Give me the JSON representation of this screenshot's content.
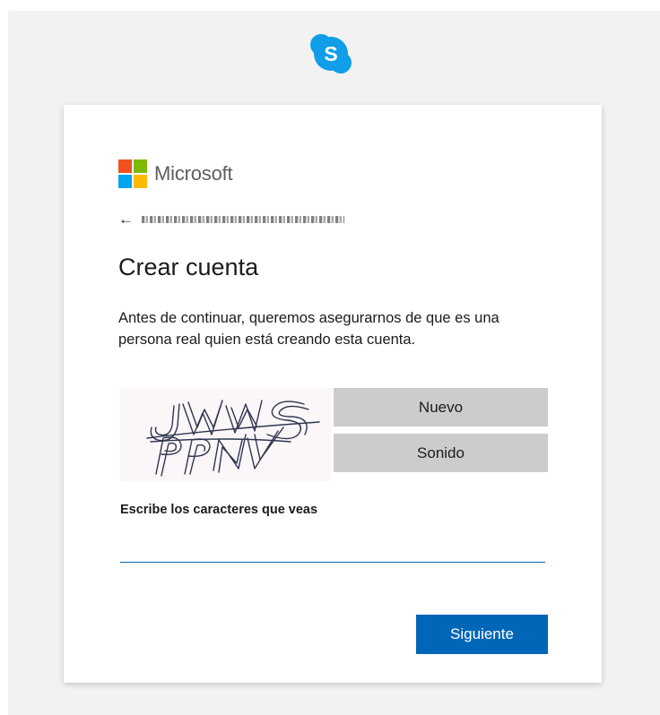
{
  "logos": {
    "skype_icon": "skype-icon",
    "microsoft_brand": "Microsoft",
    "microsoft_colors": [
      "#f25022",
      "#7fba00",
      "#00a4ef",
      "#ffb900"
    ]
  },
  "header": {
    "back_icon": "arrow-left-icon",
    "back_glyph": "←"
  },
  "main": {
    "title": "Crear cuenta",
    "description": "Antes de continuar, queremos asegurarnos de que es una persona real quien está creando esta cuenta."
  },
  "captcha": {
    "new_label": "Nuevo",
    "audio_label": "Sonido",
    "input_label": "Escribe los caracteres que veas",
    "input_value": "",
    "input_placeholder": ""
  },
  "actions": {
    "next_label": "Siguiente"
  },
  "colors": {
    "accent": "#0067b8",
    "skype_blue": "#0f9ee7",
    "card_background": "#ffffff",
    "page_background": "#f2f2f2",
    "captcha_button": "#cccccc"
  }
}
